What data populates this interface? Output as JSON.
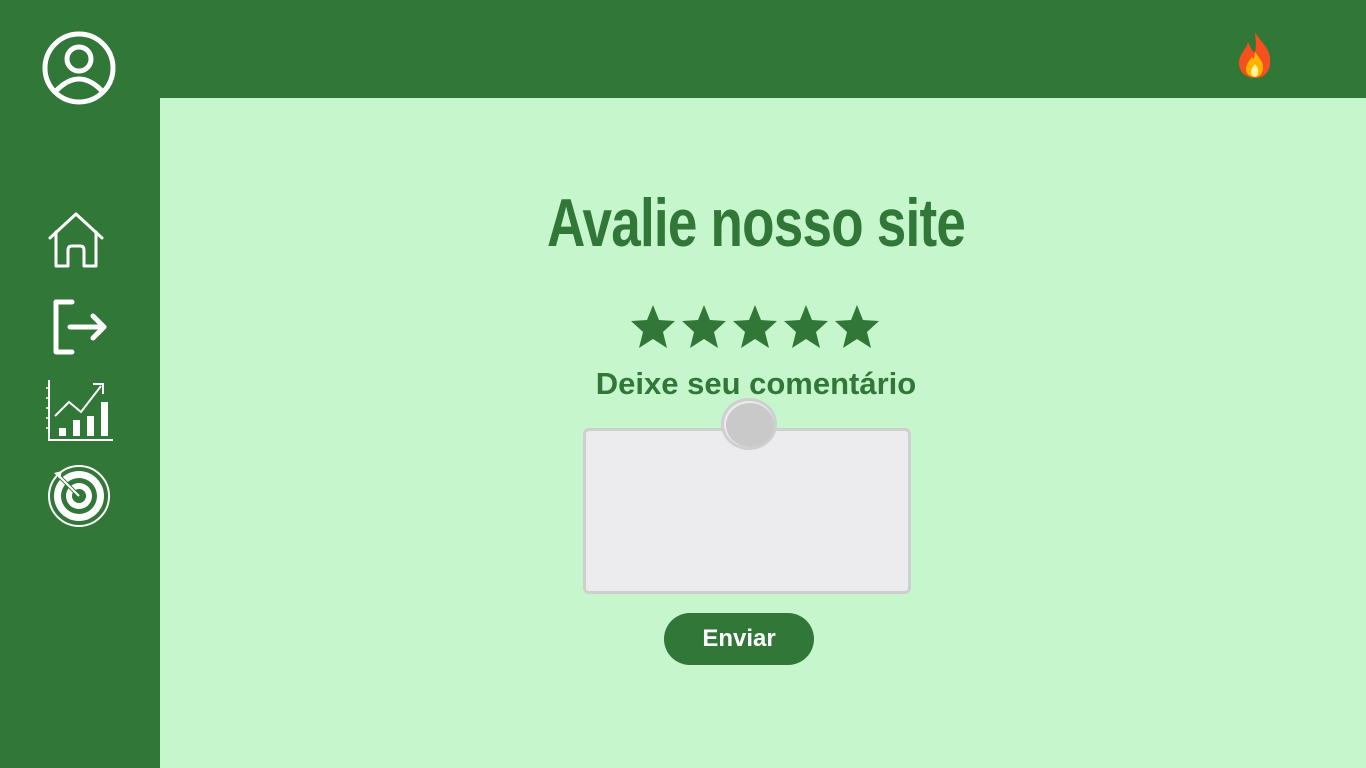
{
  "page": {
    "title": "Avalie nosso site",
    "rating_label": "Deixe seu comentário",
    "comment_placeholder": "",
    "send_label": "Enviar"
  },
  "rating": {
    "max_stars": 5,
    "filled_stars": 5
  },
  "sidebar": {
    "items": [
      {
        "icon": "home-icon"
      },
      {
        "icon": "logout-icon"
      },
      {
        "icon": "stats-chart-icon"
      },
      {
        "icon": "target-icon"
      }
    ]
  },
  "header": {
    "profile_icon": "user-profile-icon",
    "streak_icon": "fire-icon"
  },
  "colors": {
    "primary": "#307738",
    "background": "#c6f7cc",
    "white": "#ffffff"
  }
}
